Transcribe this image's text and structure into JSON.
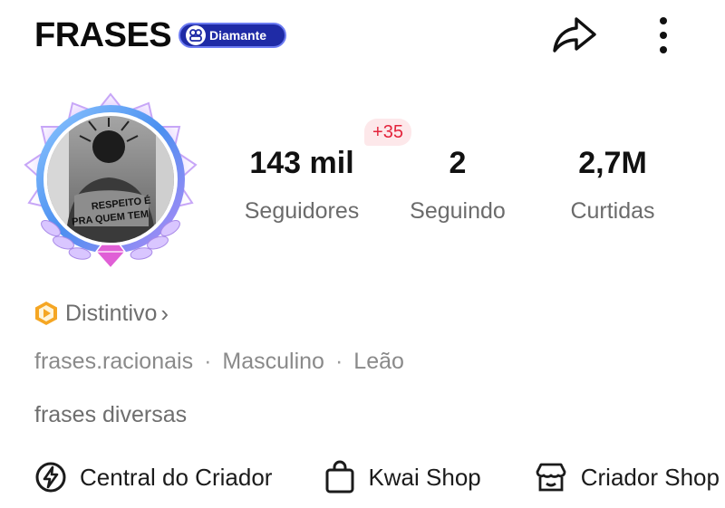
{
  "header": {
    "title": "FRASES",
    "badge_label": "Diamante",
    "share_icon": "share-arrow-icon",
    "more_icon": "more-vertical-icon"
  },
  "avatar": {
    "shirt_text_line1": "RESPEITO É",
    "shirt_text_line2": "PRA QUEM TEM"
  },
  "stats": {
    "followers": {
      "value": "143 mil",
      "label": "Seguidores",
      "delta": "+35"
    },
    "following": {
      "value": "2",
      "label": "Seguindo"
    },
    "likes": {
      "value": "2,7M",
      "label": "Curtidas"
    }
  },
  "distintivo": {
    "label": "Distintivo",
    "chevron": "›"
  },
  "info": {
    "username": "frases.racionais",
    "gender": "Masculino",
    "sign": "Leão",
    "separator": "·"
  },
  "bio": "frases diversas",
  "actions": [
    {
      "label": "Central do Criador",
      "icon": "bolt-circle-icon"
    },
    {
      "label": "Kwai Shop",
      "icon": "shopping-bag-icon"
    },
    {
      "label": "Criador Shop",
      "icon": "storefront-icon"
    }
  ],
  "colors": {
    "badge_bg": "#1f2ba6",
    "delta_text": "#e3233b",
    "delta_bg": "#fde8ea",
    "distintivo_icon": "#f5a623",
    "frame_purple": "#b48cf5",
    "frame_blue": "#5aa8f5"
  }
}
